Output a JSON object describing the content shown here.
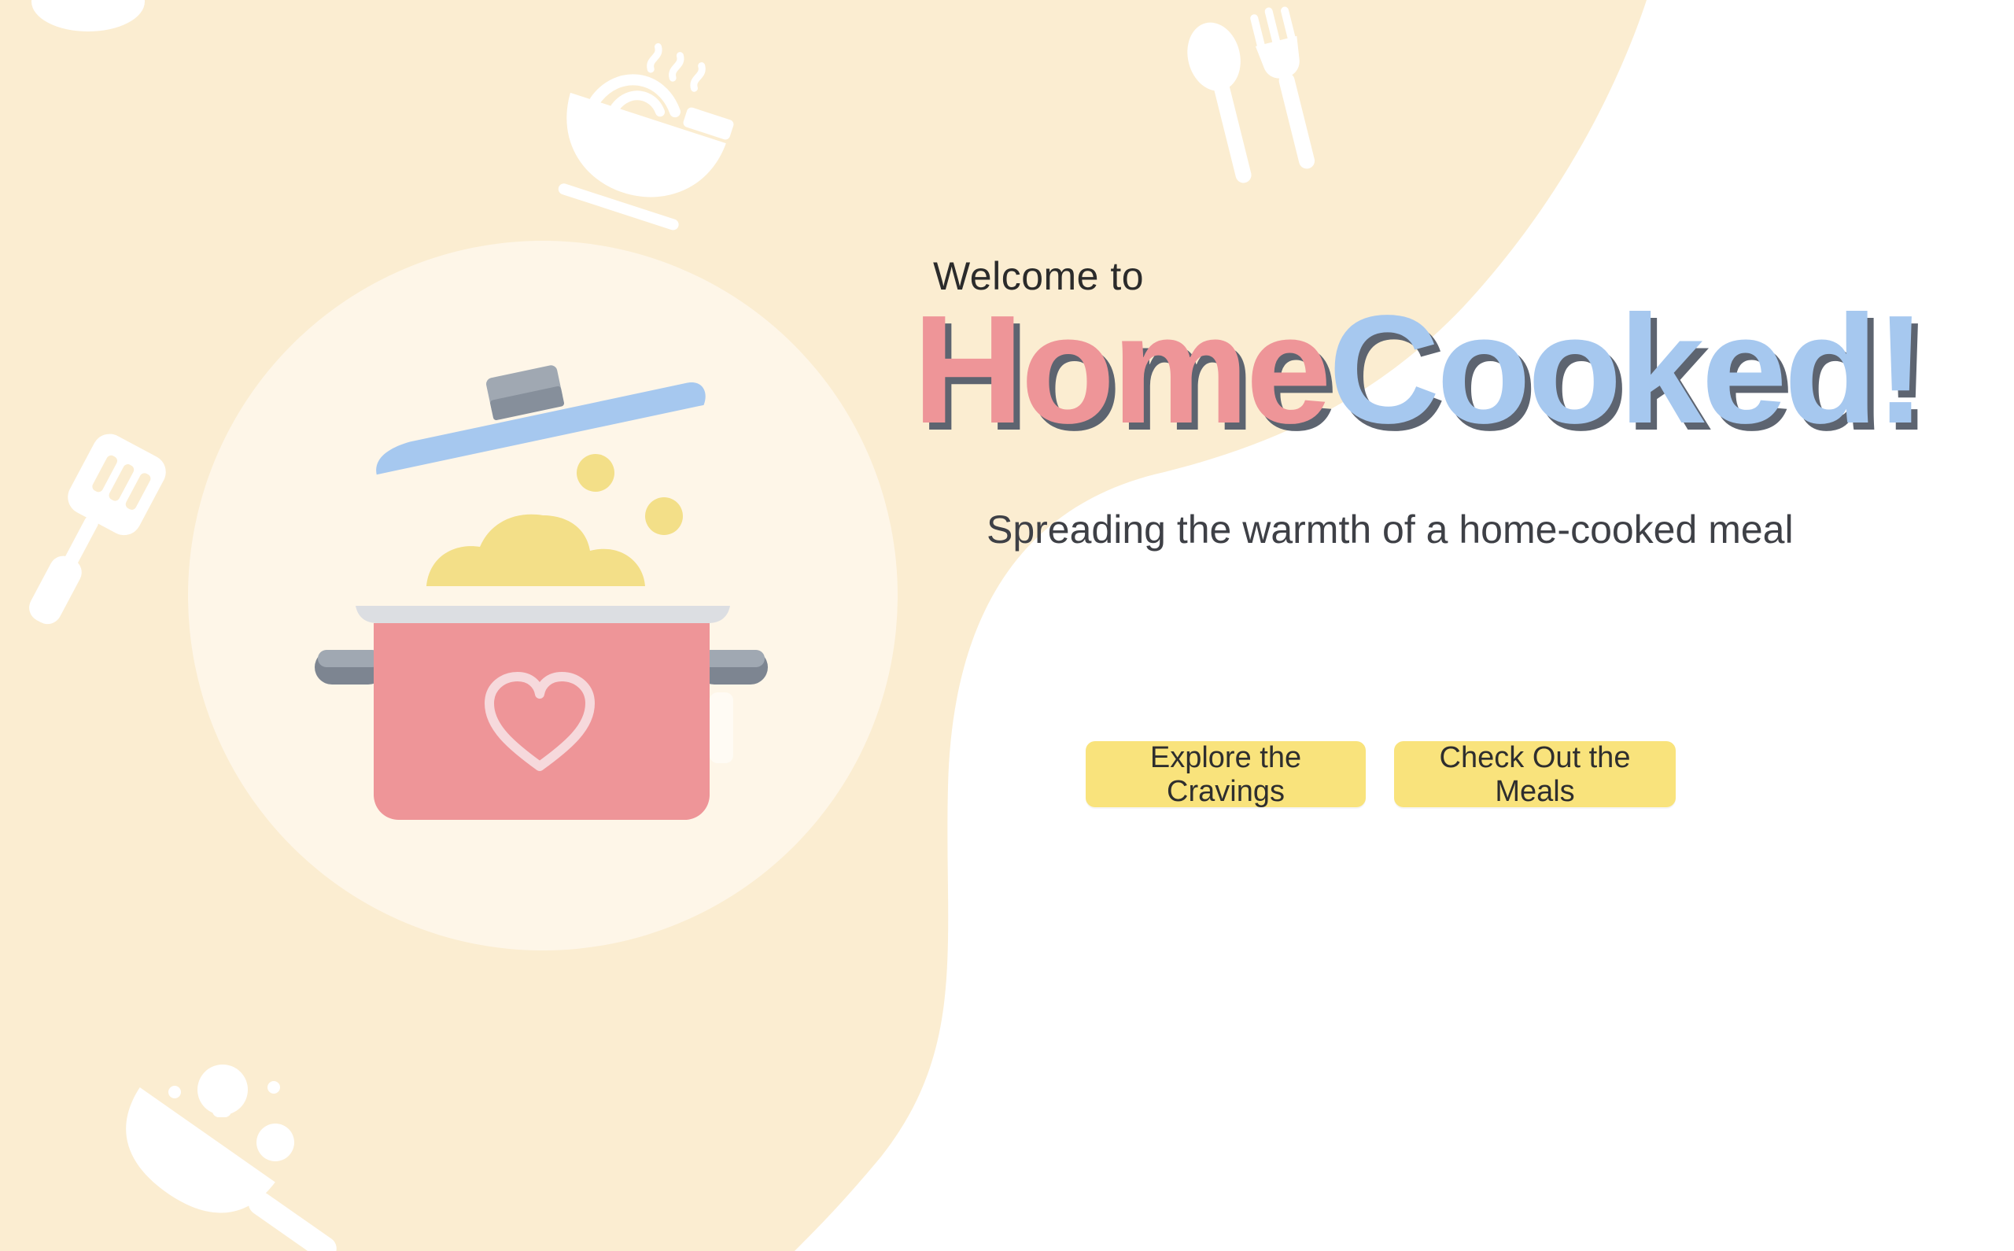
{
  "hero": {
    "welcome_text": "Welcome to",
    "brand_part1": "Home",
    "brand_part2": "Cooked!",
    "tagline": "Spreading the warmth of a home-cooked meal"
  },
  "buttons": {
    "explore_cravings": "Explore the Cravings",
    "check_meals": "Check Out the Meals"
  },
  "icons": [
    "cooking-pot-icon",
    "bowl-of-noodles-icon",
    "spoon-and-fork-icon",
    "spatula-icon",
    "frying-pan-icon",
    "plate-icon"
  ],
  "colors": {
    "background_blob": "#fbedd1",
    "page_background": "#ffffff",
    "brand_home": "#ee9598",
    "brand_cooked": "#a6c8ef",
    "button_fill": "#f9e37c",
    "pot_body": "#ee9598",
    "pot_lid": "#a6c8ef",
    "steam": "#f3df88"
  }
}
